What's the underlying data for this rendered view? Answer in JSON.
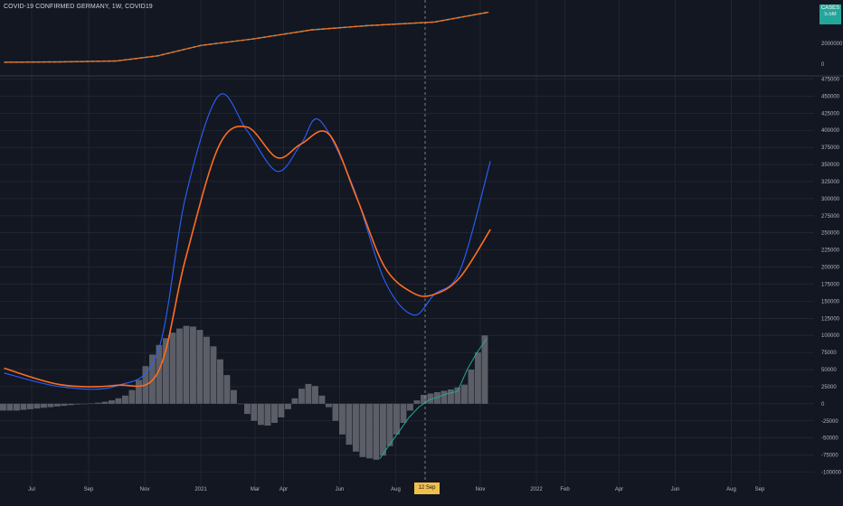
{
  "header": {
    "title": "COVID-19 CONFIRMED GERMANY, 1W, COVID19",
    "cases_badge_label": "CASES",
    "cases_badge_value": "5.5M",
    "cursor_date_label": "12 Sep '21"
  },
  "colors": {
    "background": "#131722",
    "grid": "#2a2e39",
    "cumulative_cases": "#26a69a",
    "smoothed_fast_line": "#2962ff",
    "smoothed_slow_line": "#ff6d1f",
    "histogram_bars": "#5b5e66",
    "histogram_trend": "#26a69a",
    "cursor_badge": "#f0c04a"
  },
  "chart_data": [
    {
      "type": "line",
      "panel": "upper",
      "description_series": "cumulative confirmed cases",
      "yticks": [
        "2000000",
        "0"
      ],
      "ylim": [
        0,
        5500000
      ],
      "series": [
        {
          "values_x_dates": [
            "2020-06-01",
            "2020-08-01",
            "2020-10-01",
            "2020-11-15",
            "2021-01-01",
            "2021-03-01",
            "2021-05-01",
            "2021-07-01",
            "2021-09-12",
            "2021-11-10"
          ],
          "values": [
            180000,
            215000,
            300000,
            800000,
            1800000,
            2450000,
            3300000,
            3700000,
            4050000,
            5000000
          ]
        }
      ]
    },
    {
      "type": "line+bar",
      "panel": "lower",
      "xticks": [
        "Jul",
        "Sep",
        "Nov",
        "2021",
        "Mar",
        "Apr",
        "Jun",
        "Aug",
        "Nov",
        "2022",
        "Feb",
        "Apr",
        "Jun",
        "Aug",
        "Sep"
      ],
      "yticks": [
        "475000",
        "450000",
        "425000",
        "400000",
        "375000",
        "350000",
        "325000",
        "300000",
        "275000",
        "250000",
        "225000",
        "200000",
        "175000",
        "150000",
        "125000",
        "100000",
        "75000",
        "50000",
        "25000",
        "0",
        "-25000",
        "-50000",
        "-75000",
        "-100000"
      ],
      "ylim": [
        -100000,
        475000
      ],
      "fast_line": {
        "x": [
          "2020-06-01",
          "2020-08-01",
          "2020-10-01",
          "2020-11-15",
          "2020-12-15",
          "2021-01-20",
          "2021-02-20",
          "2021-03-25",
          "2021-04-20",
          "2021-05-10",
          "2021-06-15",
          "2021-07-20",
          "2021-08-20",
          "2021-09-12",
          "2021-10-10",
          "2021-11-12"
        ],
        "values": [
          45000,
          25000,
          26000,
          75000,
          300000,
          450000,
          400000,
          340000,
          380000,
          415000,
          320000,
          180000,
          130000,
          160000,
          195000,
          355000
        ]
      },
      "slow_line": {
        "x": [
          "2020-06-01",
          "2020-08-01",
          "2020-10-01",
          "2020-11-15",
          "2020-12-15",
          "2021-01-20",
          "2021-02-20",
          "2021-03-25",
          "2021-04-20",
          "2021-05-20",
          "2021-06-20",
          "2021-07-20",
          "2021-08-20",
          "2021-09-12",
          "2021-10-10",
          "2021-11-12"
        ],
        "values": [
          52000,
          28000,
          27000,
          45000,
          210000,
          375000,
          405000,
          360000,
          380000,
          395000,
          300000,
          200000,
          162000,
          160000,
          185000,
          255000
        ]
      },
      "histogram": {
        "values": [
          -10000,
          -10000,
          -10000,
          -9000,
          -8000,
          -7000,
          -6000,
          -5000,
          -4000,
          -3000,
          -2000,
          -1000,
          0,
          500,
          1500,
          3000,
          5000,
          8000,
          12000,
          20000,
          35000,
          55000,
          72000,
          86000,
          96000,
          104000,
          110000,
          114000,
          113000,
          108000,
          98000,
          84000,
          65000,
          42000,
          20000,
          0,
          -15000,
          -25000,
          -31000,
          -32000,
          -28000,
          -20000,
          -8000,
          8000,
          22000,
          29000,
          26000,
          12000,
          -5000,
          -25000,
          -45000,
          -60000,
          -70000,
          -78000,
          -80000,
          -82000,
          -76000,
          -62000,
          -45000,
          -28000,
          -10000,
          5000,
          13000,
          15000,
          17000,
          19000,
          21000,
          24000,
          28000,
          50000,
          75000,
          100000
        ]
      },
      "histogram_trend": {
        "values": [
          -80000,
          -60000,
          -40000,
          -20000,
          -5000,
          5000,
          10000,
          15000,
          18000,
          50000,
          75000,
          95000
        ]
      }
    }
  ]
}
